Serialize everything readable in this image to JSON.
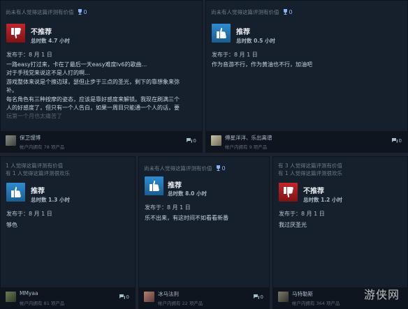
{
  "reviews": [
    {
      "recommended": false,
      "helpful_line1": "尚未有人觉得这篇评测有价值",
      "helpful_line2": "",
      "award_count": "0",
      "verdict": "不推荐",
      "hours": "总时数 4.7 小时",
      "date": "发布于：8 月 1 日",
      "text_lines": [
        "一路easy打过来，卡在了最后一天easy难度lv6的歌曲...",
        "对于手残党来说这不是人打的啊...",
        "游戏整体来说是个擦边球，瑟但止步于三点的圣光，剩下的靠想象来弥",
        "补。",
        "每名角色有三种按摩的姿态，应该是靠好感度来解锁。我现在刷满三个",
        "人的好感度了，但只有一个人告白，如果一周目只能通一个人的话，要",
        "玩第一个月也太痛苦了"
      ],
      "reviewer": "保卫馒博",
      "products": "帐户内拥有 78 项产品",
      "comments": "0"
    },
    {
      "recommended": true,
      "helpful_line1": "尚未有人觉得这篇评测有价值",
      "helpful_line2": "",
      "award_count": "0",
      "verdict": "推荐",
      "hours": "总时数 0.5 小时",
      "date": "发布于：8 月 1 日",
      "text_lines": [
        "作为音游不行，作为黄油也不行，加油吧"
      ],
      "reviewer": "傅星洋洋、乐出离谱",
      "products": "帐户内拥有 9 项产品",
      "comments": "0"
    },
    {
      "recommended": true,
      "helpful_line1": "1 人觉得这篇评测有价值",
      "helpful_line2": "有 1 人觉得这篇评测很欢乐",
      "award_count": "",
      "verdict": "推荐",
      "hours": "总时数 1.3 小时",
      "date": "发布于：8 月 1 日",
      "text_lines": [
        "够色"
      ],
      "reviewer": "MMyaa",
      "products": "帐户内拥有 81 项产品",
      "comments": "0"
    },
    {
      "recommended": true,
      "helpful_line1": "尚未有人觉得这篇评测有价值",
      "helpful_line2": "",
      "award_count": "0",
      "verdict": "推荐",
      "hours": "总时数 8.0 小时",
      "date": "发布于：8 月 1 日",
      "text_lines": [
        "乐不出来，有这时间不如看看新番"
      ],
      "reviewer": "冰马法刑",
      "products": "帐户内拥有 22 项产品",
      "comments": "0"
    },
    {
      "recommended": false,
      "helpful_line1": "有 3 人觉得这篇评测有价值",
      "helpful_line2": "有 1 人觉得这篇评测很欢乐",
      "award_count": "",
      "verdict": "不推荐",
      "hours": "总时数 1.2 小时",
      "date": "发布于：8 月 1 日",
      "text_lines": [
        "我过厌圣光"
      ],
      "reviewer": "马特勒斯",
      "products": "帐户内拥有 364 项产品",
      "comments": "0"
    }
  ],
  "watermark": "游侠网",
  "colors": {
    "card_bg": "#16202d",
    "recommended": "#2f8ccf",
    "not_recommended": "#c2262f",
    "award": "#8ab4f8"
  }
}
